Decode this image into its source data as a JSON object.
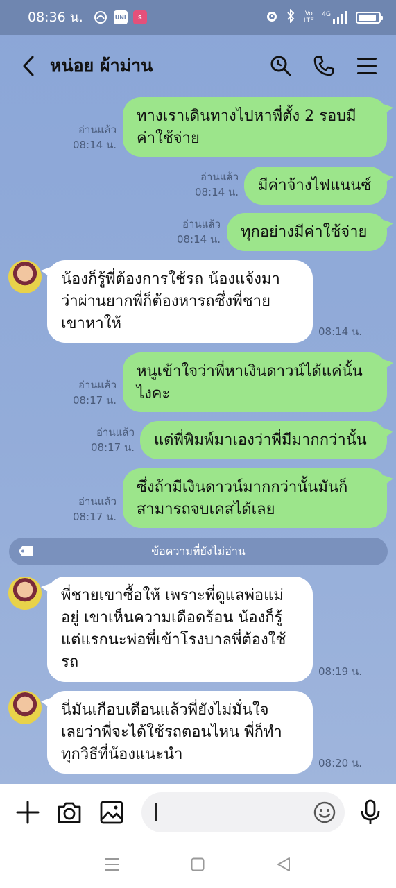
{
  "status_bar": {
    "time": "08:36 น.",
    "network": "4G",
    "volte": "Vo LTE"
  },
  "header": {
    "title": "หน่อย ผ้าม่าน"
  },
  "messages": [
    {
      "direction": "out",
      "lines": [
        "ทางเราเดินทางไปหาพี่ตั้ง 2 รอบมี",
        "ค่าใช้จ่าย"
      ],
      "read_label": "อ่านแล้ว",
      "time": "08:14 น."
    },
    {
      "direction": "out",
      "lines": [
        "มีค่าจ้างไฟแนนซ์"
      ],
      "read_label": "อ่านแล้ว",
      "time": "08:14 น."
    },
    {
      "direction": "out",
      "lines": [
        "ทุกอย่างมีค่าใช้จ่าย"
      ],
      "read_label": "อ่านแล้ว",
      "time": "08:14 น."
    },
    {
      "direction": "in",
      "lines": [
        "น้องก็รู้พี่ต้องการใช้รถ น้องแจ้งมา",
        "ว่าผ่านยากพี่ก็ต้องหารถซึ่งพี่ชาย",
        "เขาหาให้"
      ],
      "time": "08:14 น."
    },
    {
      "direction": "out",
      "lines": [
        "หนูเข้าใจว่าพี่หาเงินดาวน์ได้แค่นั้น",
        "ไงคะ"
      ],
      "read_label": "อ่านแล้ว",
      "time": "08:17 น."
    },
    {
      "direction": "out",
      "lines": [
        "แต่พี่พิมพ์มาเองว่าพี่มีมากกว่านั้น"
      ],
      "read_label": "อ่านแล้ว",
      "time": "08:17 น."
    },
    {
      "direction": "out",
      "lines": [
        "ซึ่งถ้ามีเงินดาวน์มากกว่านั้นมันก็",
        "สามารถจบเคสได้เลย"
      ],
      "read_label": "อ่านแล้ว",
      "time": "08:17 น."
    },
    {
      "direction": "in",
      "lines": [
        "พี่ชายเขาซื้อให้ เพราะพี่ดูแลพ่อแม่",
        "อยู่ เขาเห็นความเดือดร้อน น้องก็รู้",
        "แต่แรกนะพ่อพี่เข้าโรงบาลพี่ต้องใช้",
        "รถ"
      ],
      "time": "08:19 น."
    },
    {
      "direction": "in",
      "lines": [
        "นี่มันเกือบเดือนแล้วพี่ยังไม่มั่นใจ",
        "เลยว่าพี่จะได้ใช้รถตอนไหน พี่ก็ทำ",
        "ทุกวิธีที่น้องแนะนำ"
      ],
      "time": "08:20 น."
    }
  ],
  "unread_divider": "ข้อความที่ยังไม่อ่าน",
  "input": {
    "value": "",
    "placeholder": ""
  },
  "icons": {
    "back": "chevron-left-icon",
    "search": "search-icon",
    "call": "phone-icon",
    "menu": "hamburger-icon",
    "add": "plus-icon",
    "camera": "camera-icon",
    "gallery": "image-icon",
    "emoji": "emoji-icon",
    "mic": "microphone-icon"
  },
  "colors": {
    "outgoing_bubble": "#9ce58b",
    "incoming_bubble": "#ffffff",
    "chat_background": "#8ba6d7"
  }
}
